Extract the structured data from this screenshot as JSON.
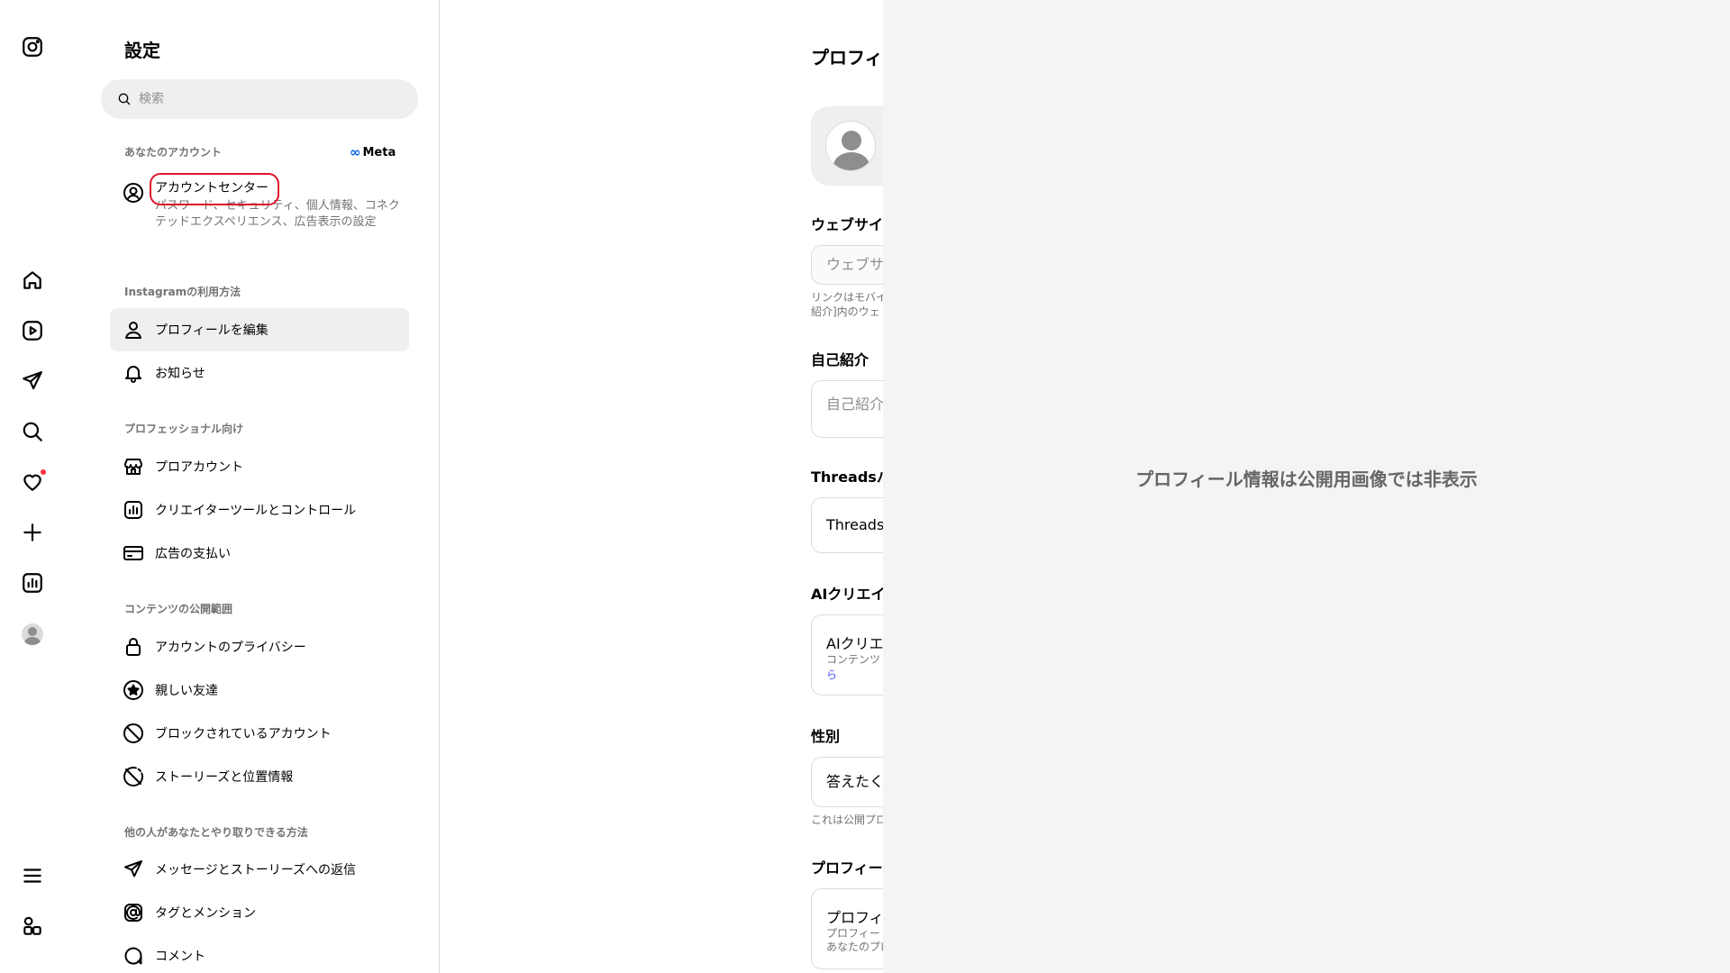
{
  "rail": {
    "icons": [
      "instagram-logo-icon",
      "home-icon",
      "reels-icon",
      "messages-icon",
      "search-icon",
      "notifications-icon",
      "create-icon",
      "dashboard-icon",
      "profile-avatar",
      "more-icon",
      "meta-apps-icon"
    ]
  },
  "settings": {
    "title": "設定",
    "search_placeholder": "検索",
    "sections": {
      "your_account": "あなたのアカウント",
      "how_you_use": "Instagramの利用方法",
      "professional": "プロフェッショナル向け",
      "visibility": "コンテンツの公開範囲",
      "interactions": "他の人があなたとやり取りできる方法"
    },
    "meta_label": "Meta",
    "account_center": {
      "title": "アカウントセンター",
      "description": "パスワード、セキュリティ、個人情報、コネクテッドエクスペリエンス、広告表示の設定"
    },
    "items": {
      "edit_profile": "プロフィールを編集",
      "notifications": "お知らせ",
      "pro_account": "プロアカウント",
      "creator_tools": "クリエイターツールとコントロール",
      "ad_payments": "広告の支払い",
      "privacy": "アカウントのプライバシー",
      "close_friends": "親しい友達",
      "blocked": "ブロックされているアカウント",
      "story_location": "ストーリーズと位置情報",
      "messages_replies": "メッセージとストーリーズへの返信",
      "tags_mentions": "タグとメンション",
      "comments": "コメント"
    }
  },
  "profile": {
    "title": "プロフィ",
    "website_heading": "ウェブサイ",
    "website_placeholder": "ウェブサ",
    "website_note_1": "リンクはモバイ",
    "website_note_2": "紹介]内のウェ",
    "bio_heading": "自己紹介",
    "bio_placeholder": "自己紹介",
    "threads_heading": "Threadsバ",
    "threads_value": "Threads",
    "ai_heading": "AIクリエイ",
    "ai_value": "AIクリエ",
    "ai_sub": "コンテンツ",
    "ai_link": "ら",
    "gender_heading": "性別",
    "gender_value": "答えたく",
    "gender_note": "これは公開プロ",
    "profile_heading": "プロフィー",
    "profile_value": "プロフィ",
    "profile_sub_1": "プロフィー",
    "profile_sub_2": "あなたのプロ"
  },
  "overlay": {
    "message": "プロフィール情報は公開用画像では非表示"
  }
}
